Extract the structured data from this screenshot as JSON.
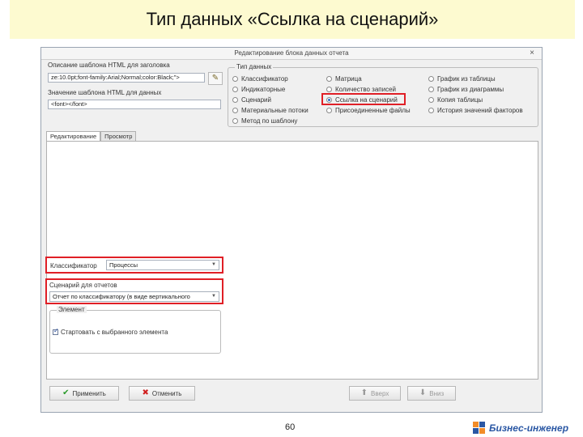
{
  "slide_title": "Тип данных «Ссылка на сценарий»",
  "dialog": {
    "title": "Редактирование блока данных отчета",
    "close_label": "×",
    "header_label": "Описание шаблона HTML для заголовка",
    "header_value": "ze:10.0pt;font-family:Arial;Normal;color:Black;\">",
    "body_label": "Значение шаблона HTML для данных",
    "body_value": "<font></font>",
    "data_type_group": "Тип данных",
    "data_types": [
      {
        "label": "Классификатор",
        "selected": false
      },
      {
        "label": "Матрица",
        "selected": false
      },
      {
        "label": "График из таблицы",
        "selected": false
      },
      {
        "label": "Индикаторные",
        "selected": false
      },
      {
        "label": "Количество записей",
        "selected": false
      },
      {
        "label": "График из диаграммы",
        "selected": false
      },
      {
        "label": "Сценарий",
        "selected": false
      },
      {
        "label": "Ссылка на сценарий",
        "selected": true
      },
      {
        "label": "Копия таблицы",
        "selected": false
      },
      {
        "label": "Материальные потоки",
        "selected": false
      },
      {
        "label": "Присоединенные файлы",
        "selected": false
      },
      {
        "label": "История значений факторов",
        "selected": false
      },
      {
        "label": "Метод по шаблону",
        "selected": false
      }
    ],
    "tabs": [
      {
        "label": "Редактирование",
        "active": true
      },
      {
        "label": "Просмотр",
        "active": false
      }
    ],
    "classifier_label": "Классификатор",
    "classifier_value": "Процессы",
    "scenario_label": "Сценарий для отчетов",
    "scenario_value": "Отчет по классификатору (в виде вертикального",
    "element_group": "Элемент",
    "element_checkbox": {
      "label": "Стартовать с выбранного элемента",
      "checked": true
    },
    "buttons": {
      "apply": "Применить",
      "cancel": "Отменить",
      "up": "Вверх",
      "down": "Вниз"
    }
  },
  "page_number": "60",
  "logo_text": "Бизнес-инженер"
}
